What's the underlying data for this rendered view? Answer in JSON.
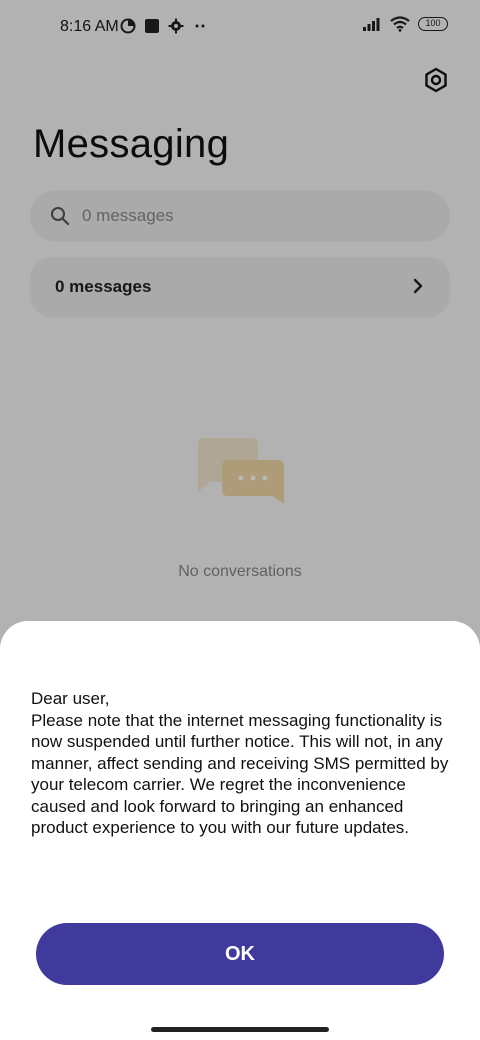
{
  "status_bar": {
    "time": "8:16 AM",
    "battery": "100",
    "left_icons": [
      "data-saver-icon",
      "square-icon",
      "settings-small-icon",
      "more-dots-icon"
    ],
    "right_icons": [
      "signal-icon",
      "wifi-icon",
      "battery-icon"
    ]
  },
  "header": {
    "title": "Messaging",
    "settings_icon": "hexagon-settings-icon"
  },
  "search": {
    "placeholder": "0 messages"
  },
  "folder": {
    "label": "0 messages"
  },
  "empty_state": {
    "text": "No conversations",
    "icon": "chat-bubbles-icon"
  },
  "dialog": {
    "message": "Dear user,\nPlease note that the internet messaging functionality is now suspended until further notice. This will not, in any manner, affect sending and receiving SMS permitted by your telecom carrier. We regret the inconvenience caused and look forward to bringing an enhanced product experience to you with our future updates.",
    "ok_label": "OK"
  },
  "colors": {
    "accent": "#3f3a9c",
    "scrim": "#000000",
    "bubble_back": "#f4e6cf",
    "bubble_front": "#f2d9a8"
  }
}
